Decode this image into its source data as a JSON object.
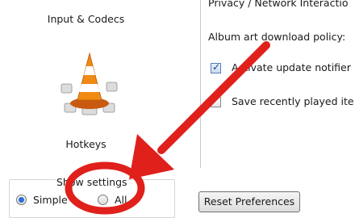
{
  "sidebar": {
    "categories": [
      {
        "label": "Input & Codecs",
        "icon": "vlc-cone-icon"
      },
      {
        "label": "Hotkeys"
      }
    ]
  },
  "show_settings": {
    "title": "Show settings",
    "options": [
      {
        "label": "Simple",
        "selected": true
      },
      {
        "label": "All",
        "selected": false
      }
    ]
  },
  "options_pane": {
    "section_title_partial": "Privacy / Network Interactio",
    "album_art_label": "Album art download policy:",
    "update_notifier_label": "Activate update notifier",
    "update_notifier_checked": true,
    "recent_items_label": "Save recently played ite",
    "recent_items_checked": false
  },
  "reset_button_label": "Reset Preferences",
  "annotation": {
    "color": "#e0201b",
    "shapes": [
      "circle",
      "arrow"
    ]
  }
}
